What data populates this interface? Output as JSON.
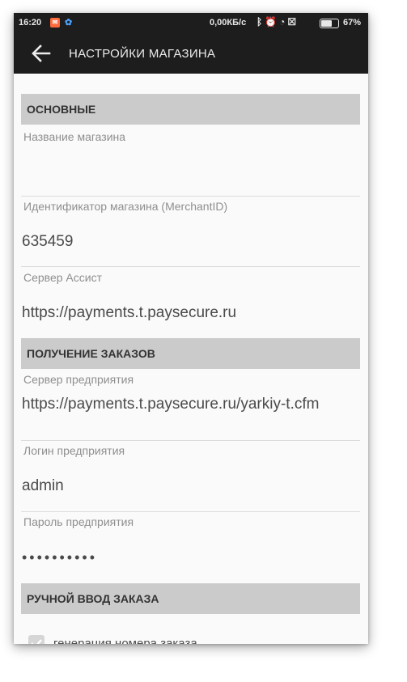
{
  "status_bar": {
    "time": "16:20",
    "speed": "0,00КБ/с",
    "battery_percent": "67%",
    "battery_level": 0.67,
    "icons": [
      "bluetooth-icon",
      "alarm-icon",
      "wifi-icon",
      "sim-icon",
      "battery-icon"
    ]
  },
  "toolbar": {
    "title": "НАСТРОЙКИ МАГАЗИНА",
    "back_icon": "arrow-left-icon"
  },
  "sections": {
    "main": {
      "header": "ОСНОВНЫЕ",
      "shop_name_label": "Название магазина",
      "shop_name_value": "",
      "merchant_id_label": "Идентификатор магазина (MerchantID)",
      "merchant_id_value": "635459",
      "assist_server_label": "Сервер Ассист",
      "assist_server_value": "https://payments.t.paysecure.ru"
    },
    "orders": {
      "header": "ПОЛУЧЕНИЕ ЗАКАЗОВ",
      "enterprise_server_label": "Сервер предприятия",
      "enterprise_server_value": "https://payments.t.paysecure.ru/yarkiy-t.cfm",
      "enterprise_login_label": "Логин предприятия",
      "enterprise_login_value": "admin",
      "enterprise_password_label": "Пароль предприятия",
      "enterprise_password_value": "••••••••••"
    },
    "manual": {
      "header": "РУЧНОЙ ВВОД ЗАКАЗА",
      "generate_number_label": "генерация номера заказа",
      "generate_number_checked": true
    }
  },
  "colors": {
    "bar_background": "#1d1d1d",
    "section_header_background": "#cbcbcb",
    "page_background": "#fafafa"
  }
}
